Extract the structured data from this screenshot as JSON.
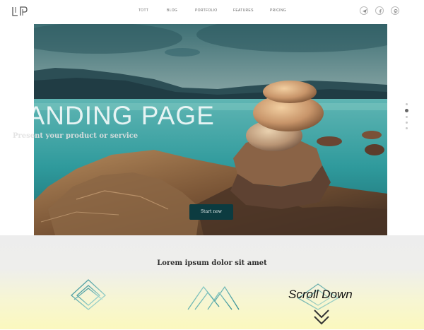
{
  "header": {
    "logo_text": "LP",
    "nav": [
      "TOTT",
      "BLOG",
      "PORTFOLIO",
      "FEATURES",
      "PRICING"
    ],
    "social_icons": [
      "paper-plane-icon",
      "facebook-icon",
      "pinterest-icon"
    ]
  },
  "hero": {
    "title": "LANDING PAGE",
    "subtitle": "Present your product or service",
    "cta_label": "Start now",
    "cta_color": "#0c3b40"
  },
  "slider_dots": {
    "count": 5,
    "active_index": 1
  },
  "lower": {
    "heading": "Lorem ipsum dolor sit amet",
    "feature_icons": [
      "diamond-stack-icon",
      "mountain-peaks-icon",
      "diamond-outline-icon"
    ]
  },
  "scroll": {
    "label": "Scroll Down",
    "icon": "double-chevron-down-icon"
  },
  "colors": {
    "accent": "#0c3b40",
    "icon_gradient_a": "#2f8a92",
    "icon_gradient_b": "#9bd6cc"
  }
}
